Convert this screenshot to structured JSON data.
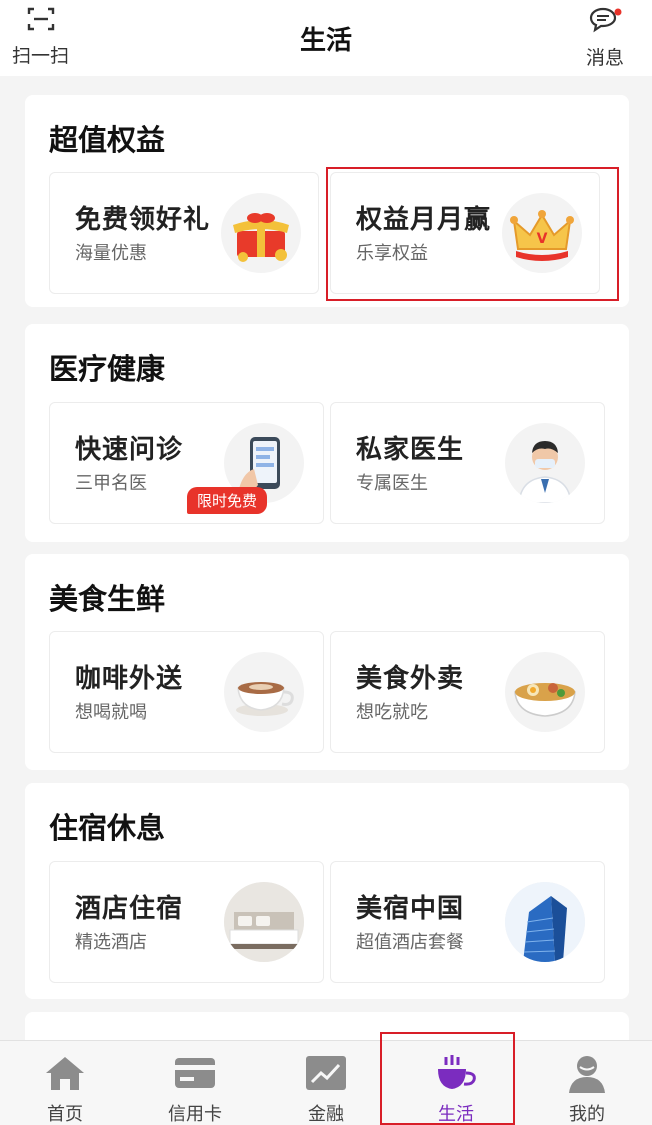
{
  "header": {
    "scan_label": "扫一扫",
    "title": "生活",
    "messages_label": "消息",
    "scan_icon": "scan-icon",
    "messages_icon": "chat-bubble-icon"
  },
  "sections": [
    {
      "title": "超值权益",
      "cards": [
        {
          "title": "免费领好礼",
          "subtitle": "海量优惠",
          "icon": "gift-box-icon"
        },
        {
          "title": "权益月月赢",
          "subtitle": "乐享权益",
          "icon": "crown-icon"
        }
      ]
    },
    {
      "title": "医疗健康",
      "cards": [
        {
          "title": "快速问诊",
          "subtitle": "三甲名医",
          "icon": "phone-in-hand-icon",
          "tag": "限时免费"
        },
        {
          "title": "私家医生",
          "subtitle": "专属医生",
          "icon": "doctor-icon"
        }
      ]
    },
    {
      "title": "美食生鲜",
      "cards": [
        {
          "title": "咖啡外送",
          "subtitle": "想喝就喝",
          "icon": "coffee-cup-icon"
        },
        {
          "title": "美食外卖",
          "subtitle": "想吃就吃",
          "icon": "food-bowl-icon"
        }
      ]
    },
    {
      "title": "住宿休息",
      "cards": [
        {
          "title": "酒店住宿",
          "subtitle": "精选酒店",
          "icon": "hotel-bed-icon"
        },
        {
          "title": "美宿中国",
          "subtitle": "超值酒店套餐",
          "icon": "building-icon"
        }
      ]
    }
  ],
  "tabbar": {
    "tabs": [
      {
        "label": "首页",
        "icon": "home-icon",
        "active": false
      },
      {
        "label": "信用卡",
        "icon": "credit-card-icon",
        "active": false
      },
      {
        "label": "金融",
        "icon": "chart-icon",
        "active": false
      },
      {
        "label": "生活",
        "icon": "coffee-icon",
        "active": true
      },
      {
        "label": "我的",
        "icon": "user-icon",
        "active": false
      }
    ]
  },
  "colors": {
    "accent_purple": "#7b2cbf",
    "tag_red": "#e8332a",
    "highlight_red": "#d81e28",
    "badge_dot": "#e8332a"
  }
}
